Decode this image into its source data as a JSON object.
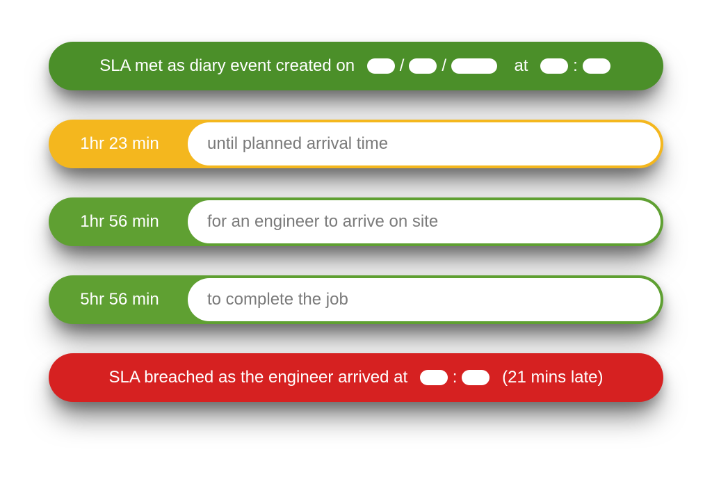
{
  "banner_top": {
    "prefix": "SLA met as diary event created on",
    "date_sep": "/",
    "at_label": "at",
    "time_sep": ":"
  },
  "rows": [
    {
      "time": "1hr 23 min",
      "desc": "until planned arrival time",
      "status": "amber"
    },
    {
      "time": "1hr 56 min",
      "desc": "for an engineer to arrive on site",
      "status": "green"
    },
    {
      "time": "5hr 56 min",
      "desc": "to complete the job",
      "status": "green"
    }
  ],
  "banner_bottom": {
    "prefix": "SLA breached as the engineer arrived at",
    "time_sep": ":",
    "suffix": "(21 mins late)"
  }
}
